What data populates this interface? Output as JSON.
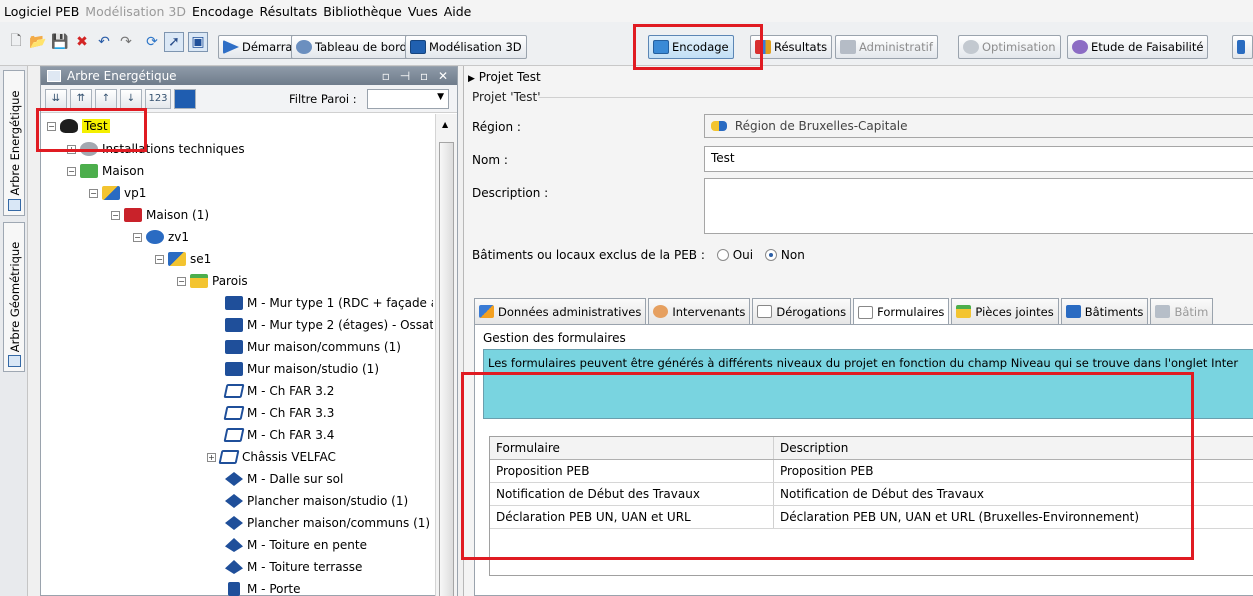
{
  "menu": [
    "Logiciel PEB",
    "Modélisation 3D",
    "Encodage",
    "Résultats",
    "Bibliothèque",
    "Vues",
    "Aide"
  ],
  "menu_disabled": [
    false,
    true,
    false,
    false,
    false,
    false,
    false
  ],
  "toolbar": {
    "buttons": [
      {
        "label": "Démarrage",
        "icon": "play-icon"
      },
      {
        "label": "Tableau de bord",
        "icon": "gauge-icon"
      },
      {
        "label": "Modélisation 3D",
        "icon": "cube-icon"
      },
      {
        "label": "Encodage",
        "icon": "encode-icon",
        "active": true
      },
      {
        "label": "Résultats",
        "icon": "bar-chart-icon"
      },
      {
        "label": "Administratif",
        "icon": "admin-icon",
        "disabled": true
      },
      {
        "label": "Optimisation",
        "icon": "optimize-icon",
        "disabled": true
      },
      {
        "label": "Etude de Faisabilité",
        "icon": "gear-icon"
      }
    ]
  },
  "vtabs": {
    "energy": "Arbre Energétique",
    "geometry": "Arbre Géométrique"
  },
  "tree": {
    "title": "Arbre Energétique",
    "filter_label": "Filtre Paroi :",
    "filter_value": "",
    "nodes": [
      {
        "label": "Test",
        "icon": "project-icon"
      },
      {
        "label": "Installations techniques",
        "icon": "installations-icon"
      },
      {
        "label": "Maison",
        "icon": "building-icon"
      },
      {
        "label": "vp1",
        "icon": "volume-icon"
      },
      {
        "label": "Maison (1)",
        "icon": "unit-icon"
      },
      {
        "label": "zv1",
        "icon": "zone-icon"
      },
      {
        "label": "se1",
        "icon": "sector-icon"
      },
      {
        "label": "Parois",
        "icon": "folder-icon"
      },
      {
        "label": "M - Mur type 1 (RDC + façade a",
        "icon": "wall-icon"
      },
      {
        "label": "M - Mur type 2 (étages) - Ossat",
        "icon": "wall-icon"
      },
      {
        "label": "Mur maison/communs (1)",
        "icon": "wall-icon"
      },
      {
        "label": "Mur maison/studio (1)",
        "icon": "wall-icon"
      },
      {
        "label": "M - Ch FAR 3.2",
        "icon": "window-icon"
      },
      {
        "label": "M - Ch FAR 3.3",
        "icon": "window-icon"
      },
      {
        "label": "M - Ch FAR 3.4",
        "icon": "window-icon"
      },
      {
        "label": "Châssis VELFAC",
        "icon": "window-icon"
      },
      {
        "label": "M - Dalle sur sol",
        "icon": "floor-icon"
      },
      {
        "label": "Plancher maison/studio (1)",
        "icon": "floor-icon"
      },
      {
        "label": "Plancher maison/communs (1)",
        "icon": "floor-icon"
      },
      {
        "label": "M - Toiture en pente",
        "icon": "roof-icon"
      },
      {
        "label": "M - Toiture terrasse",
        "icon": "roof-icon"
      },
      {
        "label": "M - Porte",
        "icon": "door-icon"
      }
    ]
  },
  "project": {
    "header": "Projet Test",
    "legend": "Projet 'Test'",
    "region_label": "Région :",
    "region_value": "Région de Bruxelles-Capitale",
    "name_label": "Nom :",
    "name_value": "Test",
    "description_label": "Description :",
    "description_value": "",
    "excluded_label": "Bâtiments ou locaux exclus de la PEB :",
    "option_yes": "Oui",
    "option_no": "Non",
    "selected_option": "Non"
  },
  "tabs": [
    {
      "label": "Données administratives",
      "icon": "admin-data-icon"
    },
    {
      "label": "Intervenants",
      "icon": "people-icon"
    },
    {
      "label": "Dérogations",
      "icon": "document-icon"
    },
    {
      "label": "Formulaires",
      "icon": "form-icon",
      "active": true
    },
    {
      "label": "Pièces jointes",
      "icon": "attachment-icon"
    },
    {
      "label": "Bâtiments",
      "icon": "building-tab-icon"
    },
    {
      "label": "Bâtim",
      "icon": "building-tab-icon",
      "disabled": true
    }
  ],
  "forms": {
    "group_title": "Gestion des formulaires",
    "info": "Les formulaires peuvent être générés à différents niveaux du projet en fonction du champ Niveau qui se trouve dans l'onglet Inter",
    "columns": [
      "Formulaire",
      "Description"
    ],
    "rows": [
      [
        "Proposition PEB",
        "Proposition PEB"
      ],
      [
        "Notification de Début des Travaux",
        "Notification de Début des Travaux"
      ],
      [
        "Déclaration PEB UN, UAN et URL",
        "Déclaration PEB UN, UAN et URL (Bruxelles-Environnement)"
      ]
    ]
  },
  "colors": {
    "highlight": "#e01b22",
    "selection": "#f4f000",
    "info_bg": "#79d4e0"
  }
}
